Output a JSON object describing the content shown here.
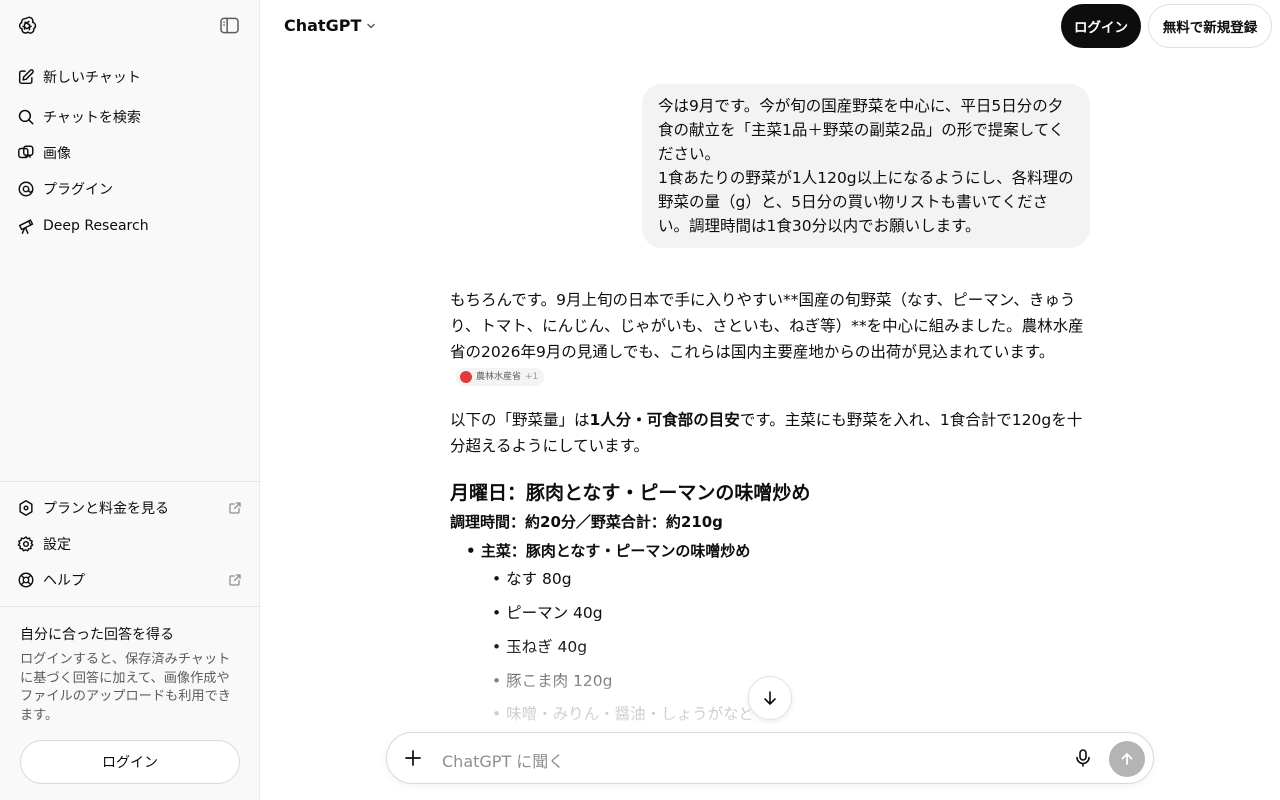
{
  "sidebar": {
    "logo_icon": "openai-logo-icon",
    "toggle_icon": "sidebar-toggle-icon",
    "nav": [
      {
        "label": "新しいチャット",
        "icon": "edit-icon"
      },
      {
        "label": "チャットを検索",
        "icon": "search-icon"
      },
      {
        "label": "画像",
        "icon": "image-icon"
      },
      {
        "label": "プラグイン",
        "icon": "plugin-icon"
      },
      {
        "label": "Deep Research",
        "icon": "telescope-icon"
      }
    ],
    "bottom": [
      {
        "label": "プランと料金を見る",
        "icon": "plan-icon",
        "external": true
      },
      {
        "label": "設定",
        "icon": "gear-icon"
      },
      {
        "label": "ヘルプ",
        "icon": "help-icon",
        "external": true
      }
    ],
    "promo": {
      "title": "自分に合った回答を得る",
      "text": "ログインすると、保存済みチャットに基づく回答に加えて、画像作成やファイルのアップロードも利用できます。",
      "login_label": "ログイン"
    }
  },
  "header": {
    "model_name": "ChatGPT",
    "login_label": "ログイン",
    "signup_label": "無料で新規登録"
  },
  "conversation": {
    "user_message": {
      "line1": "今は9月です。今が旬の国産野菜を中心に、平日5日分の夕食の献立を「主菜1品＋野菜の副菜2品」の形で提案してください。",
      "line2": "1食あたりの野菜が1人120g以上になるようにし、各料理の野菜の量（g）と、5日分の買い物リストも書いてください。調理時間は1食30分以内でお願いします。"
    },
    "assistant": {
      "para1": "もちろんです。9月上旬の日本で手に入りやすい**国産の旬野菜（なす、ピーマン、きゅうり、トマト、にんじん、じゃがいも、さといも、ねぎ等）**を中心に組みました。農林水産省の2026年9月の見通しでも、これらは国内主要産地からの出荷が見込まれています。",
      "citation_source": "農林水産省",
      "citation_more": "+1",
      "para2_pre": "以下の「野菜量」は",
      "para2_bold": "1人分・可食部の目安",
      "para2_post": "です。主菜にも野菜を入れ、1食合計で120gを十分超えるようにしています。",
      "day_heading": "月曜日：豚肉となす・ピーマンの味噌炒め",
      "day_meta": "調理時間：約20分／野菜合計：約210g",
      "main_dish": "主菜：豚肉となす・ピーマンの味噌炒め",
      "ingredients": [
        "なす 80g",
        "ピーマン 40g",
        "玉ねぎ 40g",
        "豚こま肉 120g",
        "味噌・みりん・醤油・しょうがなど"
      ]
    }
  },
  "composer": {
    "placeholder": "ChatGPT に聞く",
    "plus_icon": "plus-icon",
    "mic_icon": "microphone-icon",
    "send_icon": "arrow-up-icon"
  },
  "scroll_down_icon": "arrow-down-icon"
}
